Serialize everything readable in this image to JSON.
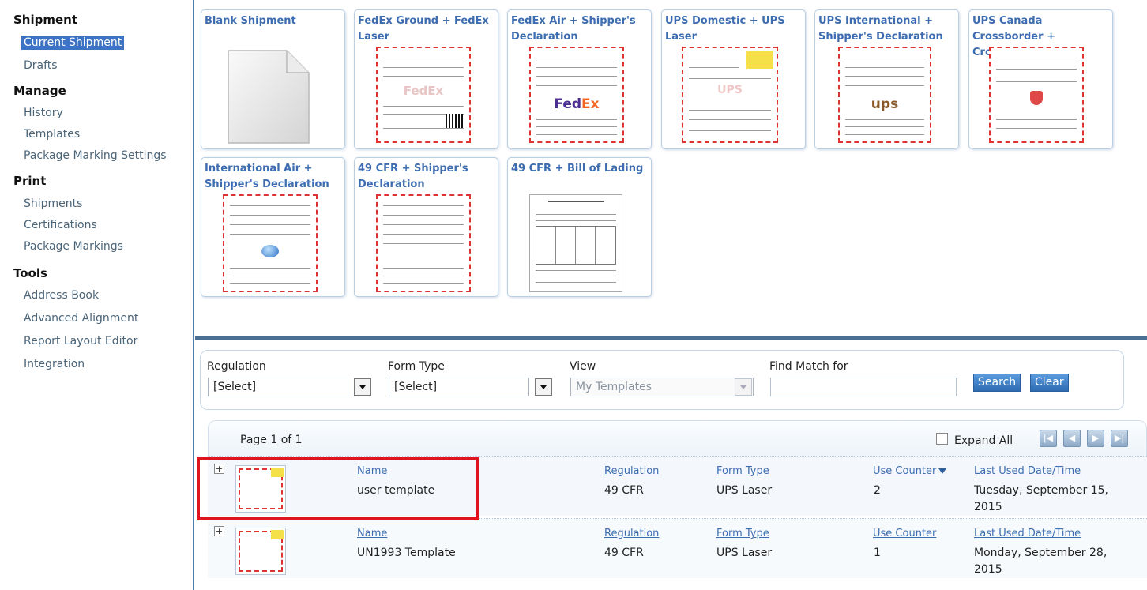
{
  "sidebar": {
    "sections": [
      {
        "heading": "Shipment",
        "items": [
          {
            "label": "Current Shipment",
            "selected": true
          },
          {
            "label": "Drafts"
          }
        ]
      },
      {
        "heading": "Manage",
        "items": [
          {
            "label": "History"
          },
          {
            "label": "Templates"
          },
          {
            "label": "Package Marking Settings"
          }
        ]
      },
      {
        "heading": "Print",
        "items": [
          {
            "label": "Shipments"
          },
          {
            "label": "Certifications"
          },
          {
            "label": "Package Markings"
          }
        ]
      },
      {
        "heading": "Tools",
        "items": [
          {
            "label": "Address Book"
          },
          {
            "label": "Advanced Alignment"
          },
          {
            "label": "Report Layout Editor"
          },
          {
            "label": "Integration"
          }
        ]
      }
    ]
  },
  "templates": [
    {
      "title": "Blank Shipment",
      "preview": "blank-document-icon"
    },
    {
      "title": "FedEx Ground + FedEx Laser",
      "preview": "form",
      "brand": "FedEx"
    },
    {
      "title": "FedEx Air + Shipper's Declaration",
      "preview": "form",
      "brand": "FedEx"
    },
    {
      "title": "UPS Domestic + UPS Laser",
      "preview": "form",
      "brand": "ups"
    },
    {
      "title": "UPS International + Shipper's Declaration",
      "preview": "form",
      "brand": "ups"
    },
    {
      "title": "UPS Canada Crossborder + Crossborder Laser",
      "preview": "form",
      "brand": "ups-logo"
    },
    {
      "title": "International Air + Shipper's Declaration",
      "preview": "form",
      "brand": "globe-logo"
    },
    {
      "title": "49 CFR + Shipper's Declaration",
      "preview": "form"
    },
    {
      "title": "49 CFR + Bill of Lading",
      "preview": "bill-of-lading"
    }
  ],
  "filter": {
    "regulation_label": "Regulation",
    "regulation_value": "[Select]",
    "formtype_label": "Form Type",
    "formtype_value": "[Select]",
    "view_label": "View",
    "view_value": "My Templates",
    "find_label": "Find Match for",
    "find_value": "",
    "search_btn": "Search",
    "clear_btn": "Clear"
  },
  "results": {
    "page_info": "Page 1 of 1",
    "expand_all": "Expand All",
    "rows": [
      {
        "name_header": "Name",
        "name": "user template",
        "regulation_header": "Regulation",
        "regulation": "49 CFR",
        "formtype_header": "Form Type",
        "formtype": "UPS Laser",
        "counter_header": "Use Counter",
        "counter": "2",
        "lastused_header": "Last Used Date/Time",
        "lastused_line1": "Tuesday, September 15,",
        "lastused_line2": "2015"
      },
      {
        "name_header": "Name",
        "name": "UN1993 Template",
        "regulation_header": "Regulation",
        "regulation": "49 CFR",
        "formtype_header": "Form Type",
        "formtype": "UPS Laser",
        "counter_header": "Use Counter",
        "counter": "1",
        "lastused_header": "Last Used Date/Time",
        "lastused_line1": "Monday, September 28,",
        "lastused_line2": "2015"
      }
    ]
  },
  "colors": {
    "accent": "#3d73c4",
    "link": "#3d6db0",
    "highlight": "#e0141e",
    "hazard": "#dd3333"
  }
}
